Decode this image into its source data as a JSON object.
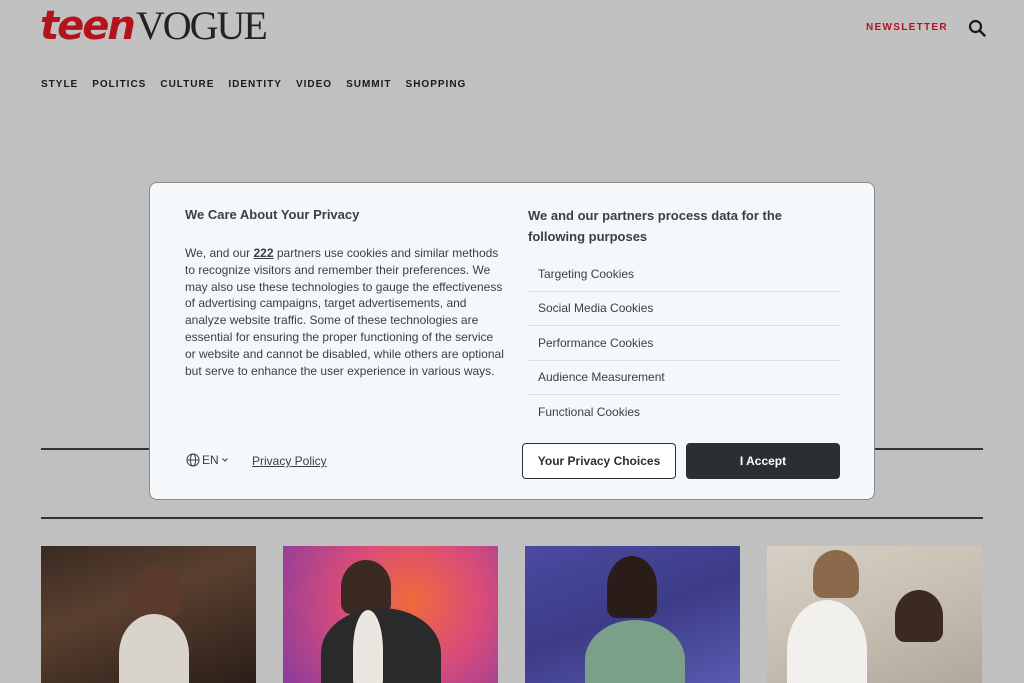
{
  "header": {
    "logo_teen": "teen",
    "logo_vogue": "VOGUE",
    "newsletter_label": "NEWSLETTER",
    "accent_color": "#b3141b"
  },
  "nav": {
    "items": [
      {
        "label": "STYLE"
      },
      {
        "label": "POLITICS"
      },
      {
        "label": "CULTURE"
      },
      {
        "label": "IDENTITY"
      },
      {
        "label": "VIDEO"
      },
      {
        "label": "SUMMIT"
      },
      {
        "label": "SHOPPING"
      }
    ]
  },
  "consent": {
    "title": "We Care About Your Privacy",
    "body_prefix": "We, and our ",
    "partner_count": "222",
    "body_suffix": " partners use cookies and similar methods to recognize visitors and remember their preferences. We may also use these technologies to gauge the effectiveness of advertising campaigns, target advertisements, and analyze website traffic. Some of these technologies are essential for ensuring the proper functioning of the service or website and cannot be disabled, while others are optional but serve to enhance the user experience in various ways.",
    "purposes_title": "We and our partners process data for the following purposes",
    "purposes": [
      {
        "label": "Targeting Cookies"
      },
      {
        "label": "Social Media Cookies"
      },
      {
        "label": "Performance Cookies"
      },
      {
        "label": "Audience Measurement"
      },
      {
        "label": "Functional Cookies"
      }
    ],
    "language_label": "EN",
    "privacy_policy_label": "Privacy Policy",
    "choices_button_label": "Your Privacy Choices",
    "accept_button_label": "I Accept"
  }
}
